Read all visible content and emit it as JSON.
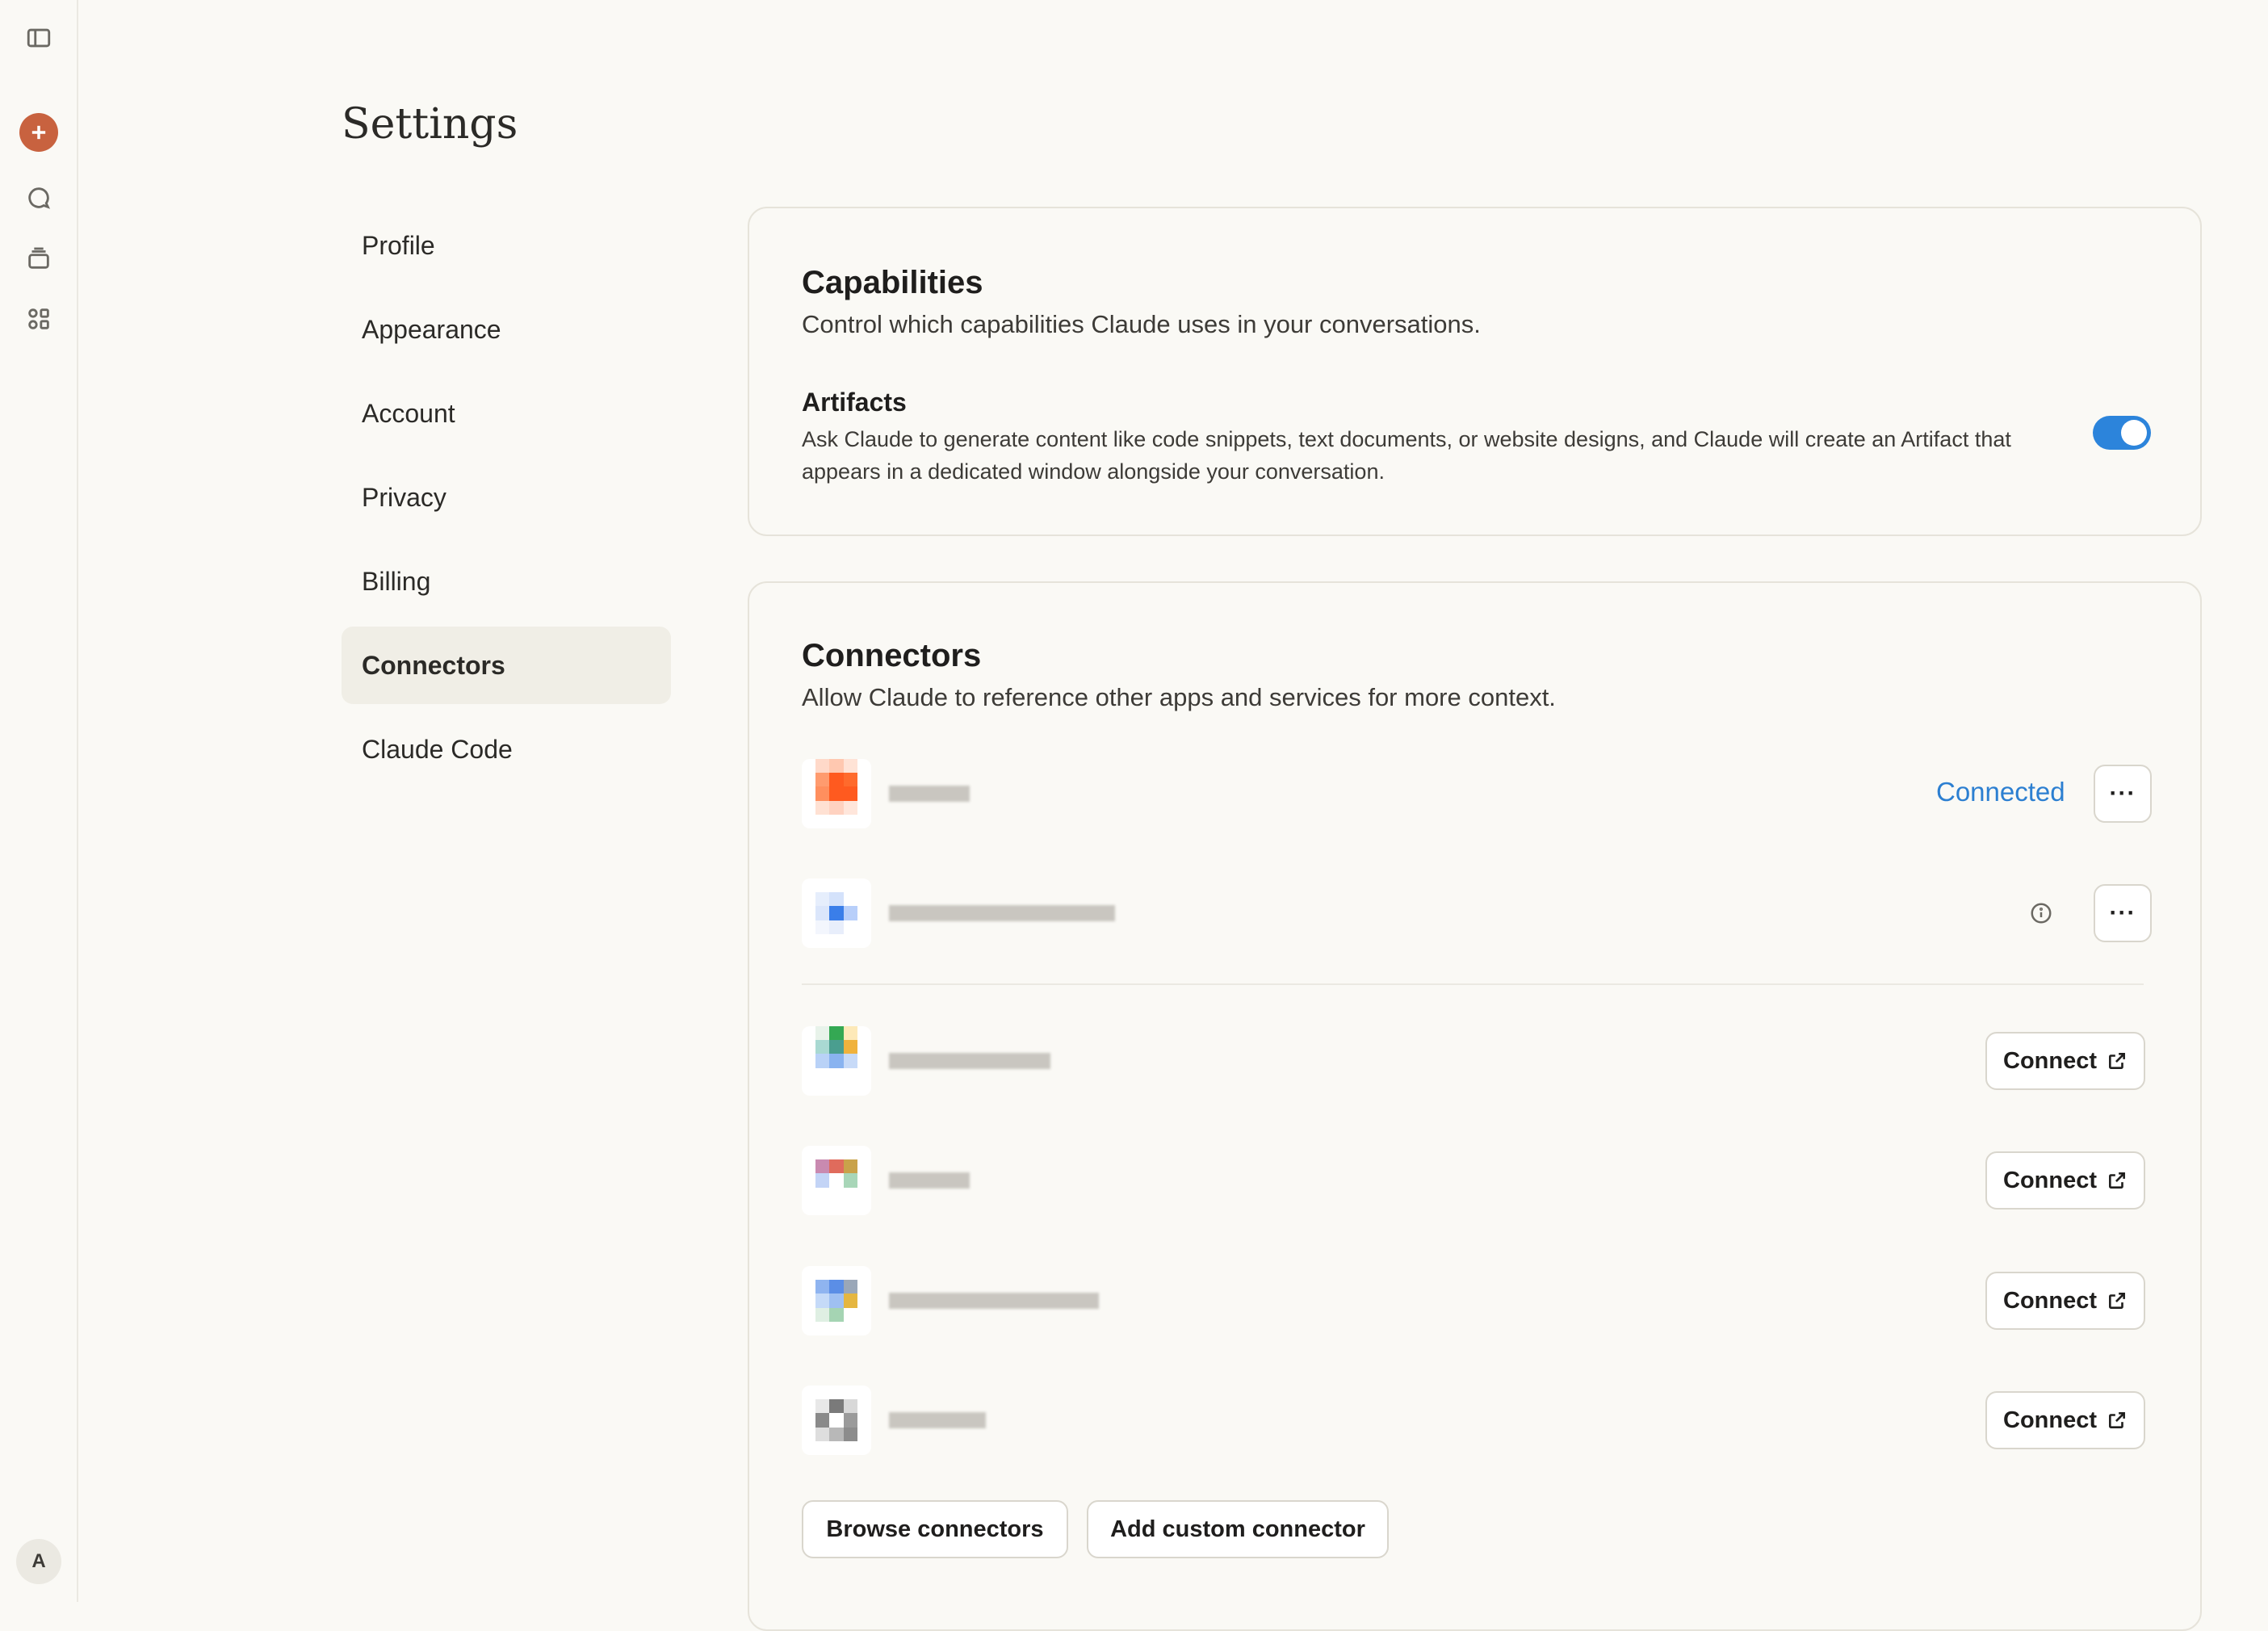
{
  "rail": {
    "icons": [
      "sidebar-toggle-icon",
      "new-chat-icon",
      "chats-icon",
      "projects-icon",
      "artifacts-icon"
    ],
    "avatar_initial": "A"
  },
  "page": {
    "title": "Settings"
  },
  "nav": {
    "items": [
      {
        "label": "Profile",
        "active": false
      },
      {
        "label": "Appearance",
        "active": false
      },
      {
        "label": "Account",
        "active": false
      },
      {
        "label": "Privacy",
        "active": false
      },
      {
        "label": "Billing",
        "active": false
      },
      {
        "label": "Connectors",
        "active": true
      },
      {
        "label": "Claude Code",
        "active": false
      }
    ]
  },
  "capabilities": {
    "title": "Capabilities",
    "subtitle": "Control which capabilities Claude uses in your conversations.",
    "artifacts": {
      "title": "Artifacts",
      "description": "Ask Claude to generate content like code snippets, text documents, or website designs, and Claude will create an Artifact that appears in a dedicated window alongside your conversation.",
      "enabled": true
    }
  },
  "connectors": {
    "title": "Connectors",
    "subtitle": "Allow Claude to reference other apps and services for more context.",
    "connected_label": "Connected",
    "more_label": "···",
    "connect_label": "Connect",
    "browse_label": "Browse connectors",
    "add_custom_label": "Add custom connector",
    "accent_color": "#2c7fd1"
  }
}
